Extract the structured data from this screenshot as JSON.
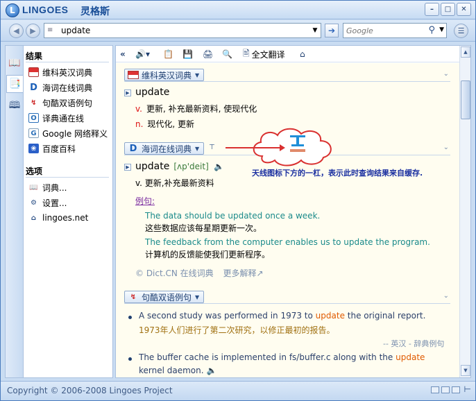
{
  "app": {
    "title": "LINGOES",
    "title_cn": "灵格斯",
    "logo_letter": "L",
    "window_buttons": [
      "–",
      "□",
      "✕"
    ]
  },
  "nav": {
    "back_icon": "back-arrow-icon",
    "forward_icon": "forward-arrow-icon",
    "query": "update",
    "web_search_placeholder": "Google",
    "go_icon": "go-arrow-icon"
  },
  "sidebar": {
    "results_heading": "结果",
    "results": [
      {
        "label": "维科英汉词典",
        "icon": "flag-icon"
      },
      {
        "label": "海词在线词典",
        "icon": "dict-d-icon"
      },
      {
        "label": "句酷双语例句",
        "icon": "jukuu-icon"
      },
      {
        "label": "译典通在线",
        "icon": "dreye-icon"
      },
      {
        "label": "Google 网络释义",
        "icon": "google-icon"
      },
      {
        "label": "百度百科",
        "icon": "baidu-paw-icon"
      }
    ],
    "options_heading": "选项",
    "options": [
      {
        "label": "词典...",
        "icon": "dictionary-icon"
      },
      {
        "label": "设置...",
        "icon": "settings-icon"
      },
      {
        "label": "lingoes.net",
        "icon": "home-icon"
      }
    ]
  },
  "toolbar": {
    "full_translate": "全文翻译"
  },
  "entries": {
    "d1": {
      "name": "维科英汉词典",
      "headword": "update",
      "senses": [
        {
          "pos": "v.",
          "def": "更新, 补充最新资料, 使现代化"
        },
        {
          "pos": "n.",
          "def": "现代化, 更新"
        }
      ]
    },
    "d2": {
      "name": "海词在线词典",
      "headword": "update",
      "phonetic": "[ʌp'deit]",
      "def": "v. 更新,补充最新资料",
      "examples_label": "例句:",
      "examples": [
        {
          "en": "The data should be updated once a week.",
          "cn": "这些数据应该每星期更新一次。"
        },
        {
          "en": "The feedback from the computer enables us to update the program.",
          "cn": "计算机的反馈能使我们更新程序。"
        }
      ],
      "source": "© Dict.CN 在线词典",
      "more": "更多解释"
    },
    "d3": {
      "name": "句酷双语例句",
      "sentences": [
        {
          "en_before": "A second study was performed in 1973 to ",
          "en_hl": "update",
          "en_after": " the original report.",
          "cn": "1973年人们进行了第二次研究，以修正最初的报告。",
          "source": "-- 英汉 - 辞典例句"
        },
        {
          "en_before": "The buffer cache is implemented in fs/buffer.c along with the ",
          "en_hl": "update",
          "en_after": "",
          "en_line2": "kernel daemon."
        }
      ]
    }
  },
  "annotation": {
    "text": "天线图标下方的一杠，表示此时查询结果来自缓存."
  },
  "status": {
    "copyright": "Copyright © 2006-2008 Lingoes Project"
  }
}
